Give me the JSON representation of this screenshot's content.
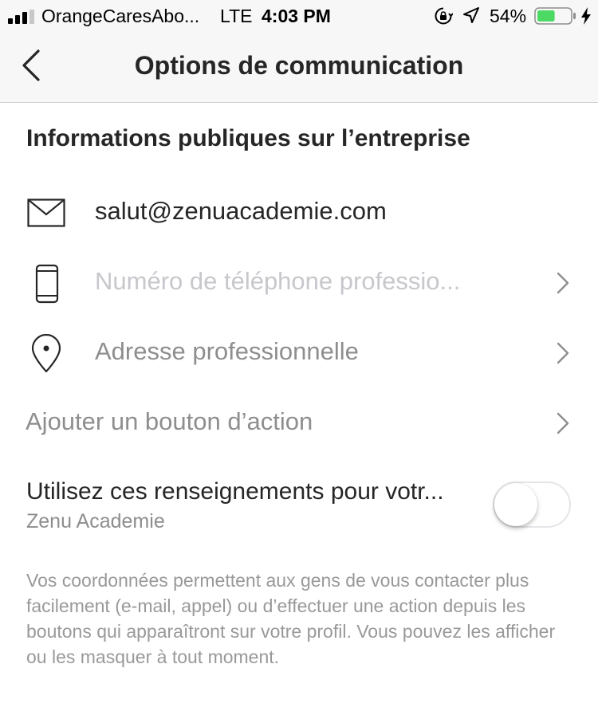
{
  "status_bar": {
    "carrier": "OrangeCaresAbo...",
    "network": "LTE",
    "time": "4:03 PM",
    "battery_percent": "54%",
    "battery_level": 0.54,
    "battery_color": "#4cd964"
  },
  "nav": {
    "title": "Options de communication",
    "back_icon": "chevron-left-icon"
  },
  "section": {
    "title": "Informations publiques sur l’entreprise"
  },
  "contact": {
    "email": "salut@zenuacademie.com",
    "phone_placeholder": "Numéro de téléphone professio...",
    "address": "Adresse professionnelle",
    "action_button": "Ajouter un bouton d’action"
  },
  "share": {
    "label": "Utilisez ces renseignements pour votr...",
    "sublabel": "Zenu Academie",
    "enabled": false
  },
  "footnote": "Vos coordonnées permettent aux gens de vous contacter plus facilement (e-mail, appel) ou d’effectuer une action depuis les boutons qui apparaîtront sur votre profil. Vous pouvez les afficher ou les masquer à tout moment."
}
